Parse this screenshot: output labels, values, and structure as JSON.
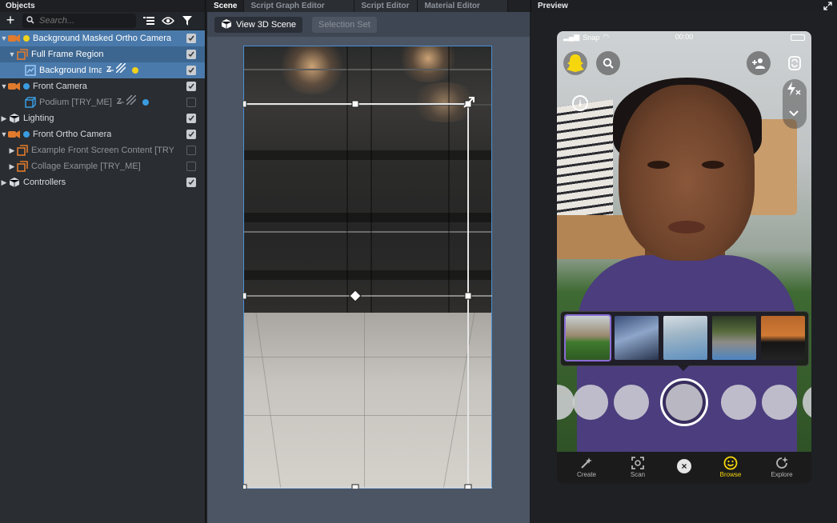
{
  "objects_panel": {
    "title": "Objects",
    "search_placeholder": "Search...",
    "items": [
      {
        "label": "Background Masked Ortho Camera",
        "checked": true
      },
      {
        "label": "Full Frame Region",
        "checked": true
      },
      {
        "label": "Background Image",
        "checked": true
      },
      {
        "label": "Front Camera",
        "checked": true
      },
      {
        "label": "Podium [TRY_ME]",
        "checked": false
      },
      {
        "label": "Lighting",
        "checked": true
      },
      {
        "label": "Front Ortho Camera",
        "checked": true
      },
      {
        "label": "Example Front Screen Content [TRY_ME]",
        "checked": false
      },
      {
        "label": "Collage Example [TRY_ME]",
        "checked": false
      },
      {
        "label": "Controllers",
        "checked": true
      }
    ],
    "colors": {
      "selected": "#4a7aab",
      "camera_orange": "#e07b2e",
      "yellow_dot": "#f2d21b",
      "blue_dot": "#3a9be0"
    }
  },
  "scene_panel": {
    "tabs": [
      {
        "label": "Scene",
        "active": true
      },
      {
        "label": "Script Graph Editor",
        "active": false
      },
      {
        "label": "Script Editor",
        "active": false
      },
      {
        "label": "Material Editor",
        "active": false
      }
    ],
    "view_3d_label": "View 3D Scene",
    "selection_set_label": "Selection Set"
  },
  "preview_panel": {
    "title": "Preview",
    "status_carrier": "Snap",
    "status_time": "00:00",
    "nav": [
      {
        "label": "Create",
        "active": false
      },
      {
        "label": "Scan",
        "active": false
      },
      {
        "label": "Browse",
        "active": true
      },
      {
        "label": "Explore",
        "active": false
      }
    ],
    "info_glyph": "i",
    "close_glyph": "×",
    "accent": "#f6d60c"
  }
}
